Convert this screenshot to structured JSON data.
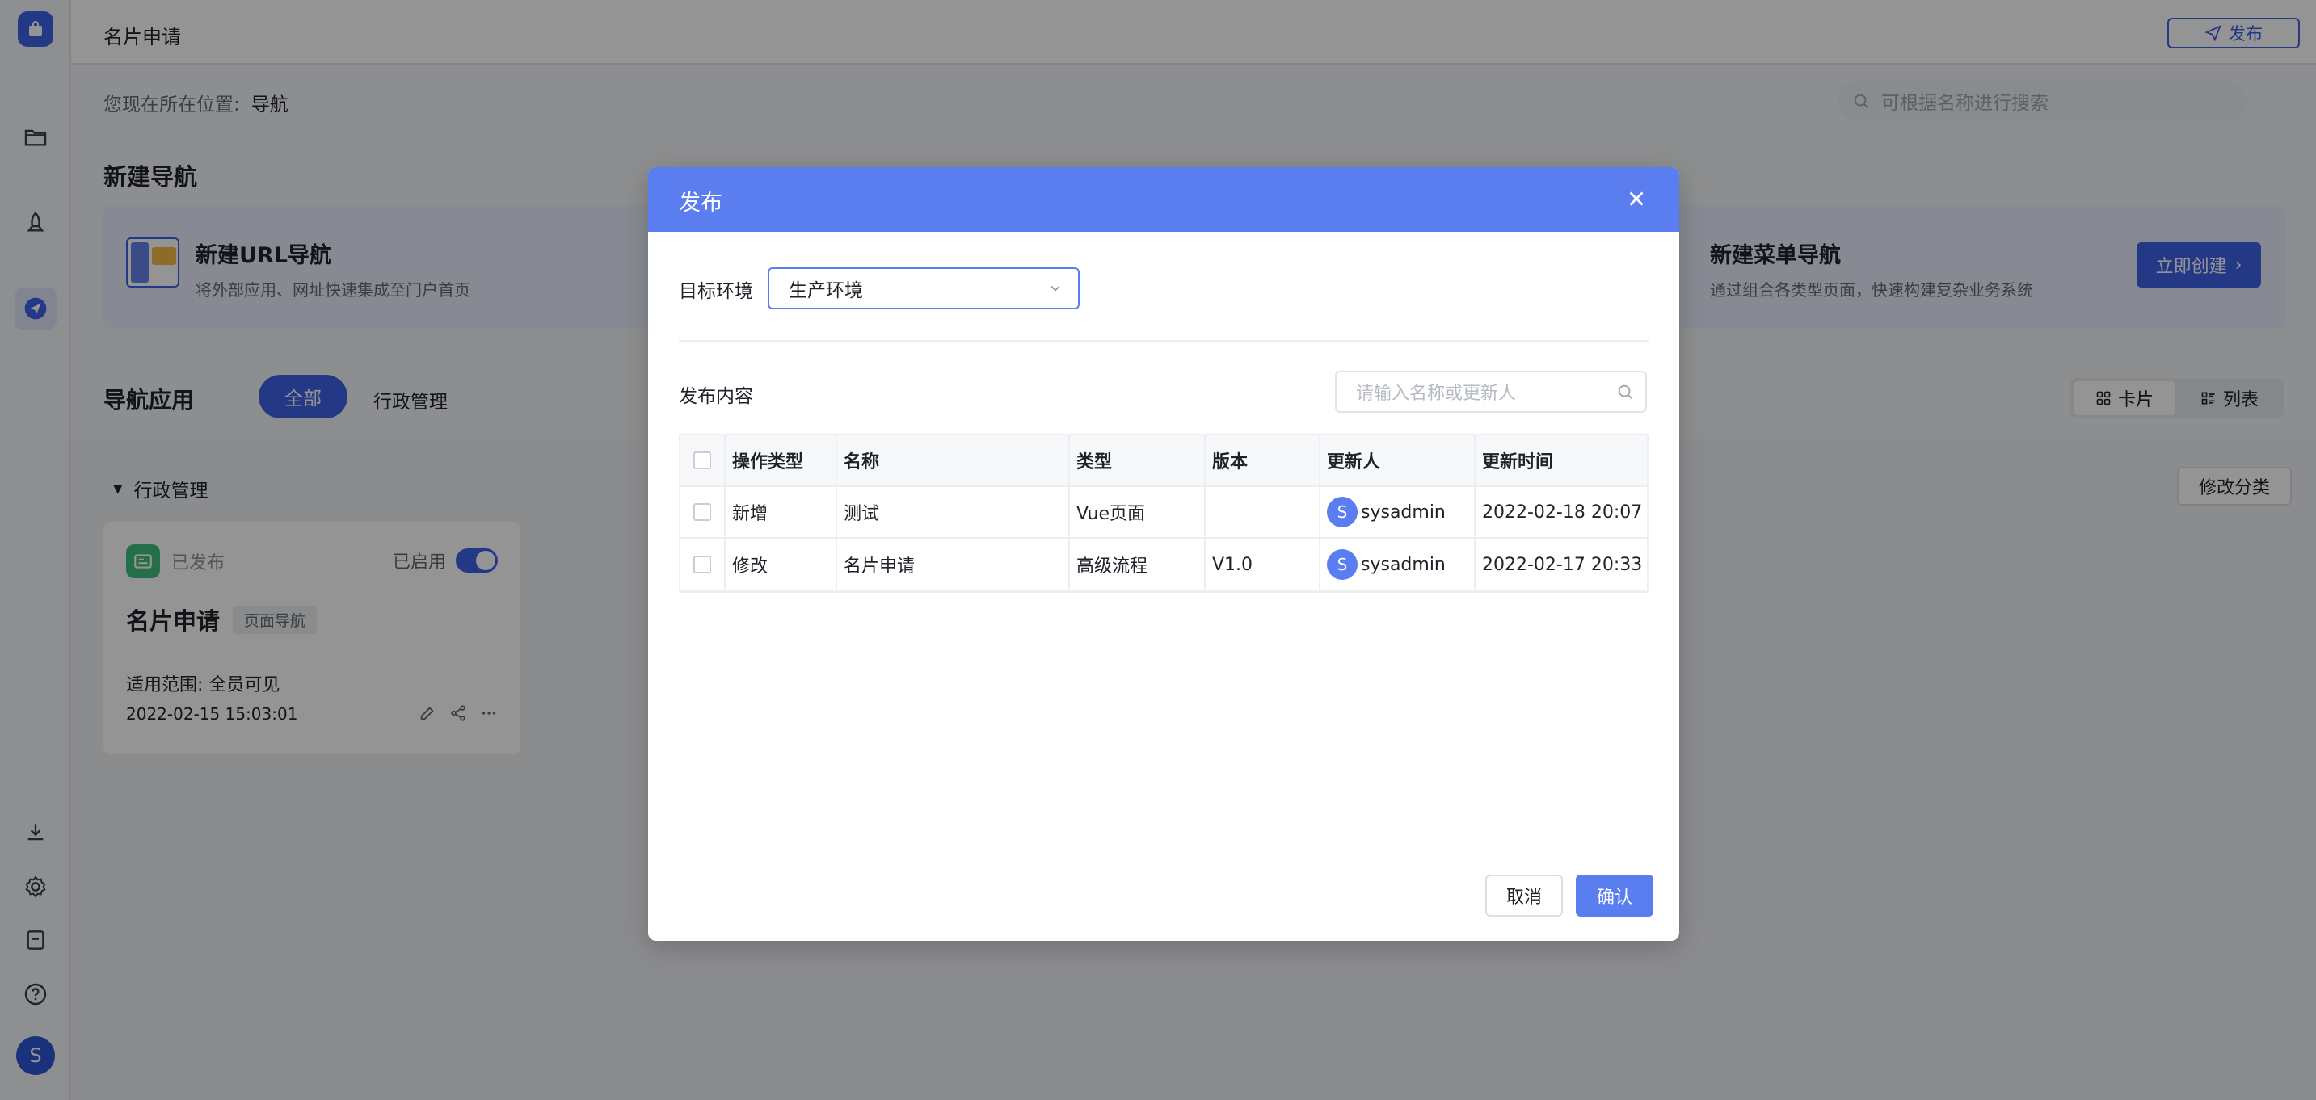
{
  "app": {
    "title": "名片申请",
    "publish_button": "发布"
  },
  "breadcrumb": {
    "prefix": "您现在所在位置:",
    "current": "导航"
  },
  "search": {
    "placeholder": "可根据名称进行搜索"
  },
  "new_nav": {
    "title": "新建导航",
    "url_nav": {
      "title": "新建URL导航",
      "desc": "将外部应用、网址快速集成至门户首页"
    },
    "menu_nav": {
      "title": "新建菜单导航",
      "desc": "通过组合各类型页面，快速构建复杂业务系统"
    },
    "create_button": "立即创建"
  },
  "apps": {
    "title": "导航应用",
    "filters": [
      "全部",
      "行政管理"
    ],
    "view_options": [
      "卡片",
      "列表"
    ],
    "category": "行政管理",
    "edit_category_button": "修改分类",
    "card": {
      "status": "已发布",
      "enabled_label": "已启用",
      "enabled": true,
      "name": "名片申请",
      "tag": "页面导航",
      "scope": "适用范围: 全员可见",
      "date": "2022-02-15 15:03:01"
    }
  },
  "sidebar": {
    "avatar": "S",
    "icons": [
      "folder-icon",
      "rocket-icon",
      "send-icon",
      "download-icon",
      "gear-icon",
      "archive-icon",
      "help-icon"
    ]
  },
  "modal": {
    "title": "发布",
    "target_env_label": "目标环境",
    "target_env_value": "生产环境",
    "content_label": "发布内容",
    "content_search_placeholder": "请输入名称或更新人",
    "columns": [
      "操作类型",
      "名称",
      "类型",
      "版本",
      "更新人",
      "更新时间"
    ],
    "rows": [
      {
        "op": "新增",
        "name": "测试",
        "type": "Vue页面",
        "version": "",
        "user_initial": "S",
        "user": "sysadmin",
        "time": "2022-02-18 20:07"
      },
      {
        "op": "修改",
        "name": "名片申请",
        "type": "高级流程",
        "version": "V1.0",
        "user_initial": "S",
        "user": "sysadmin",
        "time": "2022-02-17 20:33"
      }
    ],
    "cancel_button": "取消",
    "confirm_button": "确认"
  },
  "colors": {
    "primary": "#3e63e6",
    "modal_header": "#5a7ef0",
    "success": "#3fbf7f"
  }
}
